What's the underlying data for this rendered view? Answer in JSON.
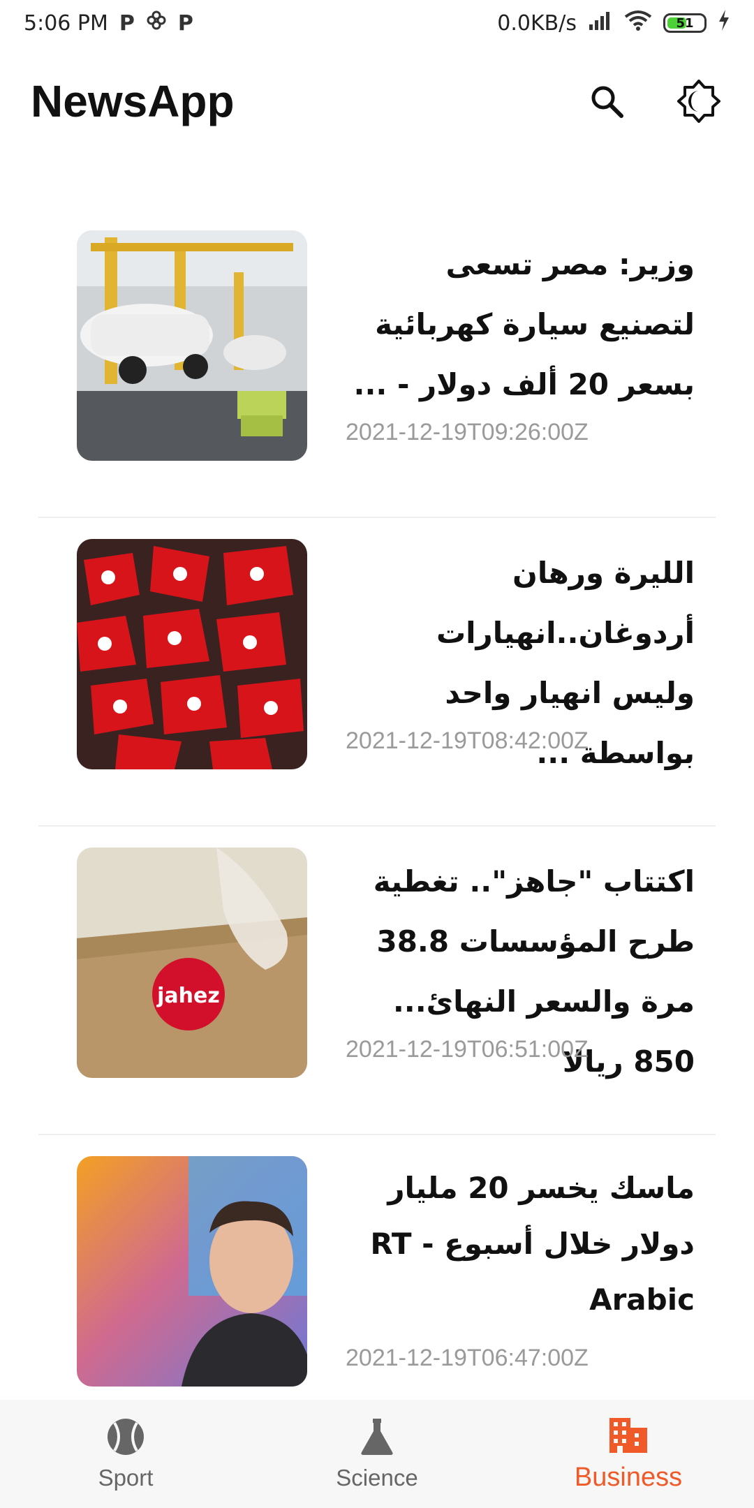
{
  "status_bar": {
    "time": "5:06 PM",
    "notif_p1": "P",
    "notif_p2": "P",
    "speed": "0.0KB/s",
    "battery": "51"
  },
  "app": {
    "title": "NewsApp"
  },
  "articles": [
    {
      "title": "وزير: مصر تسعى لتصنيع سيارة كهربائية بسعر 20 ألف دولار - ...",
      "date": "2021-12-19T09:26:00Z"
    },
    {
      "title": "الليرة ورهان أردوغان..انهيارات وليس انهيار واحد بواسطة ...",
      "date": "2021-12-19T08:42:00Z"
    },
    {
      "title": "اكتتاب \"جاهز\".. تغطية طرح المؤسسات 38.8 مرة والسعر النهائ... 850 ريالا",
      "date": "2021-12-19T06:51:00Z",
      "logo_text": "jahez"
    },
    {
      "title": "ماسك يخسر 20 مليار دولار خلال أسبوع - RT Arabic",
      "date": "2021-12-19T06:47:00Z"
    }
  ],
  "bottom_nav": [
    {
      "label": "Sport",
      "active": false
    },
    {
      "label": "Science",
      "active": false
    },
    {
      "label": "Business",
      "active": true
    }
  ],
  "colors": {
    "accent": "#f05a28",
    "inactive": "#666666"
  }
}
